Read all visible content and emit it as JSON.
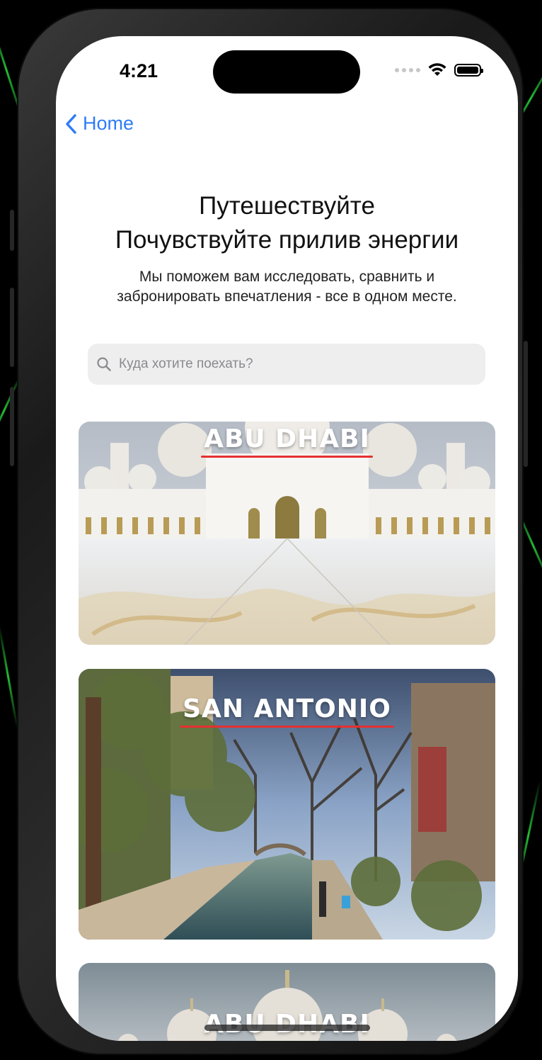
{
  "status_bar": {
    "time": "4:21"
  },
  "nav": {
    "back_label": "Home"
  },
  "header": {
    "title_line1": "Путешествуйте",
    "title_line2": "Почувствуйте прилив энергии",
    "subtitle": "Мы поможем вам исследовать, сравнить и забронировать впечатления - все в одном месте."
  },
  "search": {
    "placeholder": "Куда хотите поехать?",
    "value": ""
  },
  "destinations": [
    {
      "name": "ABU DHABI"
    },
    {
      "name": "SAN ANTONIO"
    },
    {
      "name": "ABU DHABI"
    }
  ],
  "colors": {
    "accent": "#2f7cf6",
    "underline": "#e53030"
  }
}
